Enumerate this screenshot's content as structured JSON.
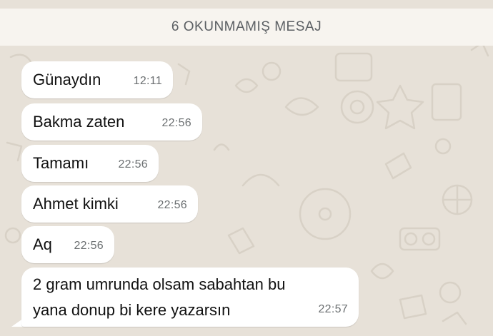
{
  "banner": {
    "text": "6 OKUNMAMIŞ MESAJ"
  },
  "messages": [
    {
      "text": "Günaydın",
      "time": "12:11"
    },
    {
      "text": "Bakma zaten",
      "time": "22:56"
    },
    {
      "text": "Tamamı",
      "time": "22:56"
    },
    {
      "text": "Ahmet kimki",
      "time": "22:56"
    },
    {
      "text": "Aq",
      "time": "22:56"
    },
    {
      "text_line1": "2 gram umrunda olsam sabahtan bu",
      "text_line2": "yana donup bi kere yazarsın",
      "time": "22:57"
    }
  ],
  "colors": {
    "wallpaper": "#e7e1d8",
    "banner_bg": "#f7f4ef",
    "banner_text": "#5b5f63",
    "bubble_bg": "#ffffff",
    "timestamp": "#6b6f71"
  }
}
